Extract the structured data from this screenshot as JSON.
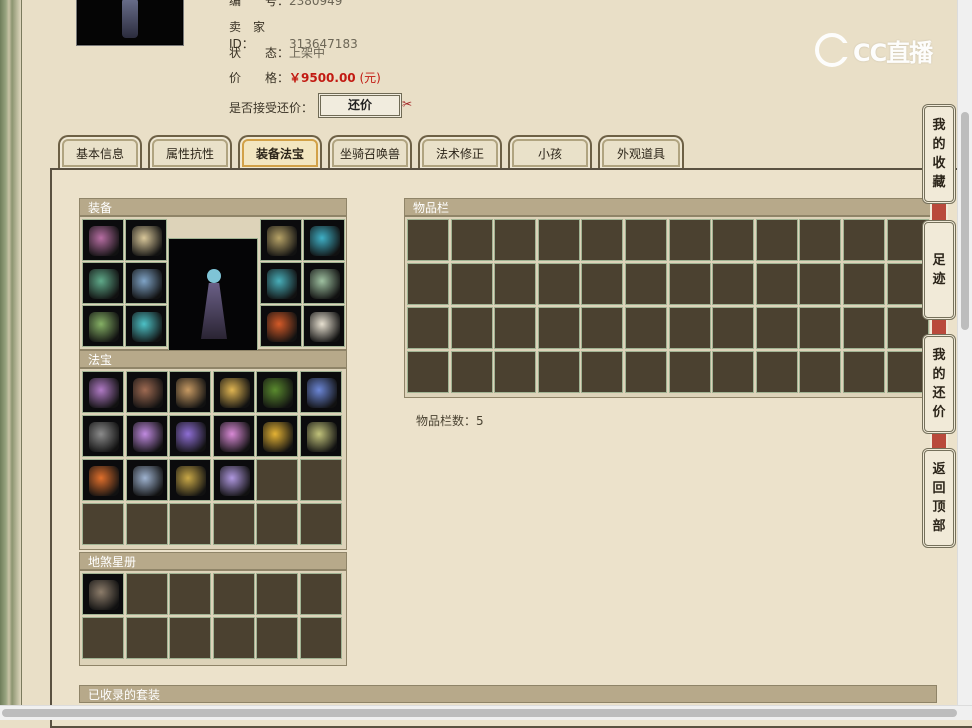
{
  "listing": {
    "number_label": "编　　号：",
    "number_value": "2380949",
    "seller_label": "卖　家　ID：",
    "seller_value": "313647183",
    "status_label": "状　　态：",
    "status_value": "上架中",
    "price_label": "价　　格：",
    "price_value": "￥9500.00",
    "price_unit": "(元)",
    "haggle_label": "是否接受还价：",
    "haggle_button": "还价"
  },
  "watermark": {
    "text": "CC直播"
  },
  "tabs": [
    {
      "label": "基本信息"
    },
    {
      "label": "属性抗性"
    },
    {
      "label": "装备法宝"
    },
    {
      "label": "坐骑召唤兽"
    },
    {
      "label": "法术修正"
    },
    {
      "label": "小孩"
    },
    {
      "label": "外观道具"
    }
  ],
  "sections": {
    "equipment": "装备",
    "treasure": "法宝",
    "star_book": "地煞星册",
    "inventory": "物品栏",
    "inventory_count_label": "物品栏数：",
    "inventory_count_value": "5",
    "collected_sets": "已收录的套装"
  },
  "sidenav": {
    "favorites": [
      "我",
      "的",
      "收",
      "藏"
    ],
    "footprints": [
      "足",
      "迹"
    ],
    "my_offers": [
      "我",
      "的",
      "还",
      "价"
    ],
    "back_top": [
      "返",
      "回",
      "顶",
      "部"
    ]
  },
  "item_colors": {
    "equipment": [
      "#b76ea3",
      "#d9c79a",
      "#5fa989",
      "#7fa3c6",
      "#85b065",
      "#4dc1c6",
      "#b7a367",
      "#3fb0c6",
      "#48aeb9",
      "#9ec0a0",
      "#d45a28",
      "#e7e0d0"
    ],
    "treasure": [
      "#b07ac5",
      "#9e6a52",
      "#c79a63",
      "#e0b552",
      "#5a8a2e",
      "#6b86d6",
      "#8b8b8b",
      "#c08ae0",
      "#8e6ed4",
      "#d98ad6",
      "#e4b234",
      "#c1c27a",
      "#e06f2c",
      "#9fb3d0",
      "#c9a847",
      "#b098e0"
    ],
    "star_book": [
      "#8c7c6a"
    ]
  }
}
